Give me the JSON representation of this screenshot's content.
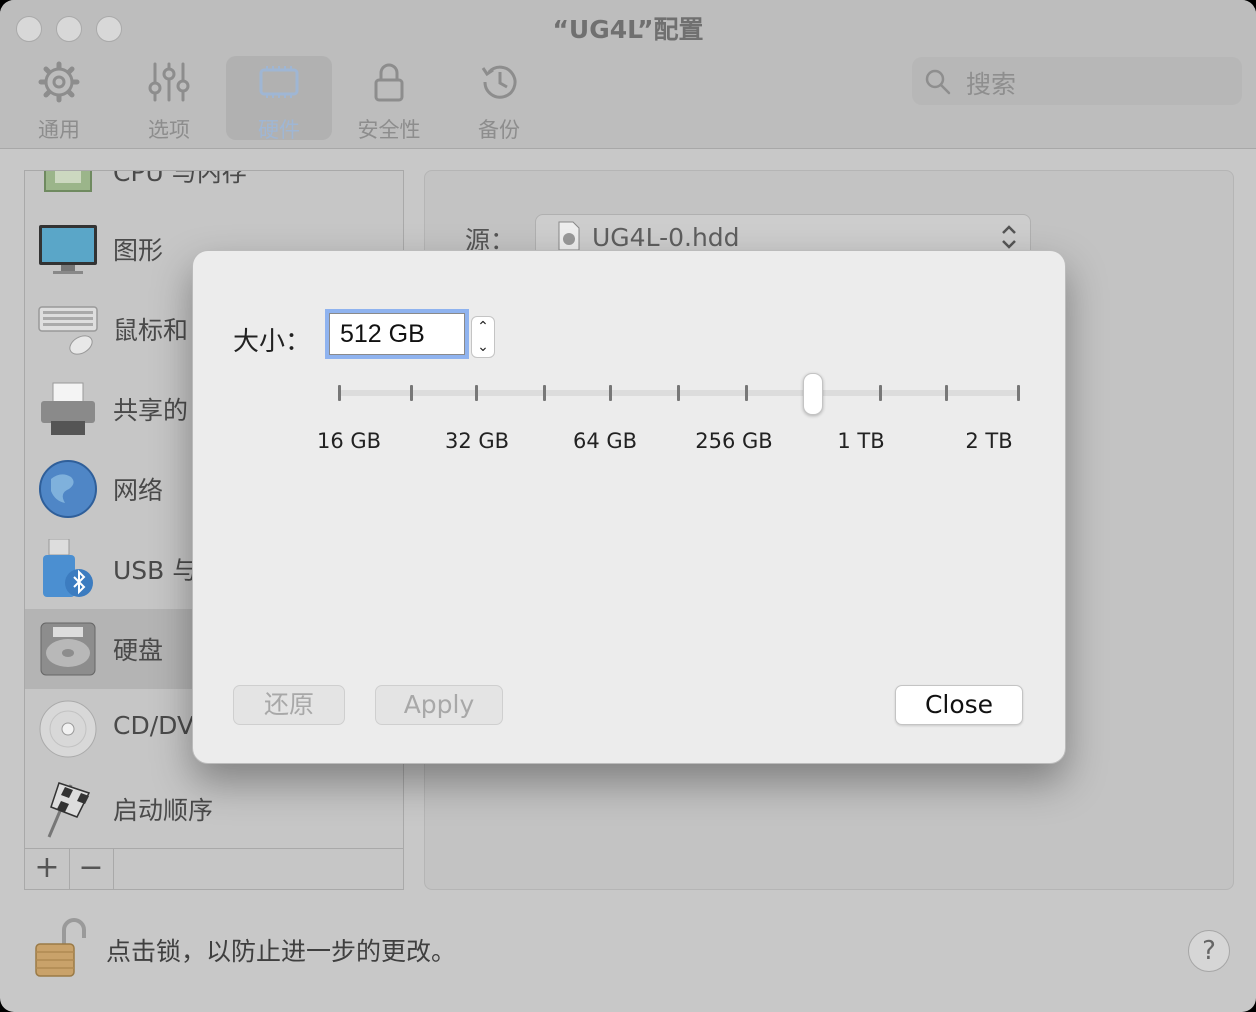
{
  "window": {
    "title": "“UG4L”配置"
  },
  "toolbar": {
    "items": [
      {
        "label": "通用",
        "icon": "gear-icon"
      },
      {
        "label": "选项",
        "icon": "sliders-icon"
      },
      {
        "label": "硬件",
        "icon": "chip-icon"
      },
      {
        "label": "安全性",
        "icon": "lock-icon"
      },
      {
        "label": "备份",
        "icon": "history-clock-icon"
      }
    ],
    "active": "硬件"
  },
  "search": {
    "placeholder": "搜索"
  },
  "sidebar": {
    "items": [
      {
        "label": "CPU 与内存",
        "icon": "cpu-icon"
      },
      {
        "label": "图形",
        "icon": "monitor-icon"
      },
      {
        "label": "鼠标和",
        "icon": "keyboard-mouse-icon"
      },
      {
        "label": "共享的",
        "icon": "printer-icon"
      },
      {
        "label": "网络",
        "icon": "globe-icon"
      },
      {
        "label": "USB 与",
        "icon": "usb-bluetooth-icon"
      },
      {
        "label": "硬盘",
        "icon": "hard-disk-icon"
      },
      {
        "label": "CD/DV",
        "icon": "cd-icon"
      },
      {
        "label": "启动顺序",
        "icon": "checkered-flag-icon"
      }
    ],
    "selected": "硬盘",
    "add_label": "+",
    "remove_label": "−"
  },
  "content": {
    "source_label": "源：",
    "source_value": "UG4L-0.hdd"
  },
  "footer": {
    "lock_text": "点击锁，以防止进一步的更改。",
    "help_label": "?"
  },
  "dialog": {
    "size_label": "大小：",
    "size_value": "512 GB",
    "slider": {
      "labels": [
        "16 GB",
        "32 GB",
        "64 GB",
        "256 GB",
        "1 TB",
        "2 TB"
      ],
      "tick_count": 11,
      "selected_tick_index": 7
    },
    "revert_label": "还原",
    "apply_label": "Apply",
    "close_label": "Close"
  }
}
